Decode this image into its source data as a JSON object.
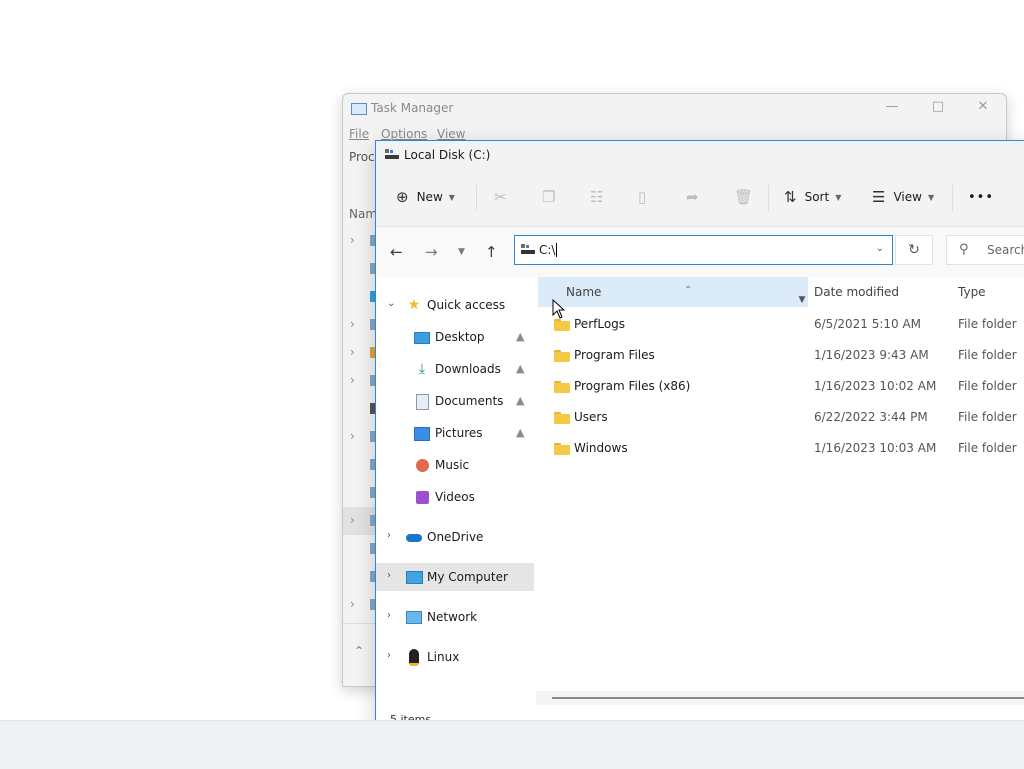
{
  "task_manager": {
    "title": "Task Manager",
    "menu": [
      "File",
      "Options",
      "View"
    ],
    "tab_partial": "Proc",
    "column_partial": "Nam"
  },
  "explorer": {
    "title": "Local Disk (C:)",
    "toolbar": {
      "new_label": "New",
      "sort_label": "Sort",
      "view_label": "View",
      "more_label": "•••"
    },
    "address": {
      "value": "C:\\"
    },
    "search": {
      "placeholder": "Search"
    },
    "nav": {
      "quick_access": "Quick access",
      "items": [
        {
          "label": "Desktop",
          "icon": "desktop-icon",
          "pinned": true
        },
        {
          "label": "Downloads",
          "icon": "downloads-icon",
          "pinned": true
        },
        {
          "label": "Documents",
          "icon": "documents-icon",
          "pinned": true
        },
        {
          "label": "Pictures",
          "icon": "pictures-icon",
          "pinned": true
        },
        {
          "label": "Music",
          "icon": "music-icon",
          "pinned": false
        },
        {
          "label": "Videos",
          "icon": "videos-icon",
          "pinned": false
        }
      ],
      "roots": [
        {
          "label": "OneDrive",
          "icon": "onedrive-icon"
        },
        {
          "label": "My Computer",
          "icon": "computer-icon",
          "selected": true
        },
        {
          "label": "Network",
          "icon": "network-icon"
        },
        {
          "label": "Linux",
          "icon": "linux-icon"
        }
      ]
    },
    "columns": {
      "name": "Name",
      "date": "Date modified",
      "type": "Type"
    },
    "files": [
      {
        "name": "PerfLogs",
        "date": "6/5/2021 5:10 AM",
        "type": "File folder"
      },
      {
        "name": "Program Files",
        "date": "1/16/2023 9:43 AM",
        "type": "File folder"
      },
      {
        "name": "Program Files (x86)",
        "date": "1/16/2023 10:02 AM",
        "type": "File folder"
      },
      {
        "name": "Users",
        "date": "6/22/2022 3:44 PM",
        "type": "File folder"
      },
      {
        "name": "Windows",
        "date": "1/16/2023 10:03 AM",
        "type": "File folder"
      }
    ],
    "status": "5 items"
  },
  "colors": {
    "accent": "#2b87d9",
    "selected_column": "#dcebfa",
    "folder": "#f6c945"
  }
}
